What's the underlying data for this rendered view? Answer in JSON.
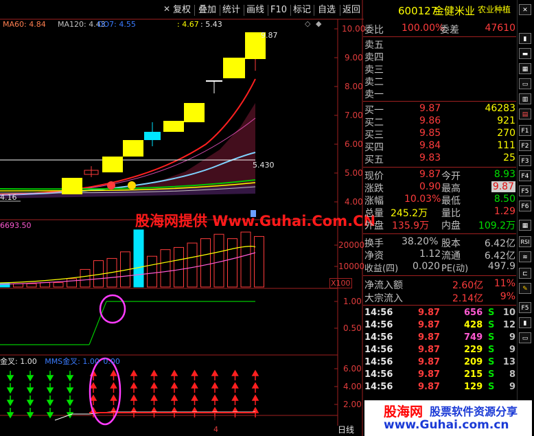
{
  "toolbar": {
    "items": [
      "复权",
      "叠加",
      "统计",
      "画线",
      "F10",
      "标记",
      "自选",
      "返回"
    ],
    "close_icon": "close-icon"
  },
  "stock": {
    "code": "600127",
    "name": "金健米业",
    "sector": "农业种植"
  },
  "chart_data": [
    {
      "type": "candlestick",
      "title": "",
      "ma_legend": [
        {
          "name": "MA60",
          "value": "4.84",
          "color": "#ff7f50"
        },
        {
          "name": "MA120",
          "value": "4.43",
          "color": "#c0c0c0"
        },
        {
          "name": "DO7",
          "value": "4.55",
          "color": "#3a7bff"
        }
      ],
      "extra_readouts": [
        "4.67",
        "5.43"
      ],
      "y_axis_ticks": [
        "10.00",
        "9.00",
        "8.00",
        "7.00",
        "6.00",
        "5.00",
        "4.00"
      ],
      "annotations": {
        "high_label": "9.87",
        "mid_label": "5.430",
        "low_label": "4.16"
      },
      "candles": [
        {
          "o": 4.16,
          "c": 4.82,
          "h": 4.82,
          "l": 4.16,
          "type": "yang-limit"
        },
        {
          "o": 5.05,
          "c": 4.95,
          "h": 5.18,
          "l": 4.9,
          "type": "doji"
        },
        {
          "o": 5.05,
          "c": 5.52,
          "h": 5.52,
          "l": 5.05,
          "type": "yang-limit"
        },
        {
          "o": 5.55,
          "c": 6.08,
          "h": 6.08,
          "l": 5.55,
          "type": "yang-limit"
        },
        {
          "o": 6.1,
          "c": 6.37,
          "h": 6.6,
          "l": 5.95,
          "type": "yin"
        },
        {
          "o": 6.33,
          "c": 6.7,
          "h": 6.7,
          "l": 6.33,
          "type": "yang-limit"
        },
        {
          "o": 6.7,
          "c": 7.37,
          "h": 7.37,
          "l": 6.5,
          "type": "yang-limit"
        },
        {
          "o": 8.1,
          "c": 8.1,
          "h": 8.1,
          "l": 7.7,
          "type": "doji"
        },
        {
          "o": 8.22,
          "c": 8.93,
          "h": 8.93,
          "l": 8.05,
          "type": "yang-limit"
        },
        {
          "o": 8.93,
          "c": 9.87,
          "h": 9.87,
          "l": 8.5,
          "type": "yang-limit"
        }
      ]
    },
    {
      "type": "bar",
      "title": "",
      "legend_value": "6693.50",
      "y_axis_ticks": [
        "20000",
        "10000"
      ],
      "unit_label": "X100",
      "values": [
        1800,
        1500,
        1500,
        2000,
        2000,
        3800,
        8000,
        12000,
        13000,
        16000,
        26000,
        14000,
        17000,
        18000,
        20000,
        22000,
        24000,
        22000,
        25000,
        23000
      ]
    },
    {
      "type": "line",
      "title": "",
      "y_axis_ticks": [
        "1.00",
        "0.50"
      ],
      "values": [
        0,
        0,
        0,
        0,
        0,
        0,
        0,
        0,
        0,
        1,
        1,
        1,
        1,
        1,
        1,
        1,
        1,
        1,
        1,
        1
      ]
    },
    {
      "type": "signal",
      "title": "",
      "legend": [
        {
          "name": "金叉",
          "value": "1.00"
        },
        {
          "name": "MMS金叉",
          "value": "1.00"
        }
      ],
      "legend_tail": "0.00",
      "y_axis_ticks": [
        "6.00",
        "4.00",
        "2.00"
      ],
      "x_marker": "4",
      "period": "日线",
      "green_arrow_columns": 4,
      "red_arrow_columns": 9
    }
  ],
  "quote": {
    "weibi_label": "委比",
    "weibi_value": "100.00%",
    "weicha_label": "委差",
    "weicha_value": "47610",
    "sell": [
      {
        "label": "卖五",
        "price": "",
        "vol": ""
      },
      {
        "label": "卖四",
        "price": "",
        "vol": ""
      },
      {
        "label": "卖三",
        "price": "",
        "vol": ""
      },
      {
        "label": "卖二",
        "price": "",
        "vol": ""
      },
      {
        "label": "卖一",
        "price": "",
        "vol": ""
      }
    ],
    "buy": [
      {
        "label": "买一",
        "price": "9.87",
        "vol": "46283"
      },
      {
        "label": "买二",
        "price": "9.86",
        "vol": "921"
      },
      {
        "label": "买三",
        "price": "9.85",
        "vol": "270"
      },
      {
        "label": "买四",
        "price": "9.84",
        "vol": "111"
      },
      {
        "label": "买五",
        "price": "9.83",
        "vol": "25"
      }
    ],
    "stats_left": [
      {
        "label": "现价",
        "value": "9.87"
      },
      {
        "label": "涨跌",
        "value": "0.90"
      },
      {
        "label": "涨幅",
        "value": "10.03%"
      },
      {
        "label": "总量",
        "value": "245.2万"
      },
      {
        "label": "外盘",
        "value": "135.9万"
      }
    ],
    "stats_right": [
      {
        "label": "今开",
        "value": "8.93"
      },
      {
        "label": "最高",
        "value": "9.87"
      },
      {
        "label": "最低",
        "value": "8.50"
      },
      {
        "label": "量比",
        "value": "1.29"
      },
      {
        "label": "内盘",
        "value": "109.2万"
      }
    ],
    "fin_left": [
      {
        "label": "换手",
        "value": "38.20%"
      },
      {
        "label": "净资",
        "value": "1.12"
      },
      {
        "label": "收益(四)",
        "value": "0.020"
      }
    ],
    "fin_right": [
      {
        "label": "股本",
        "value": "6.42亿"
      },
      {
        "label": "流通",
        "value": "6.42亿"
      },
      {
        "label": "PE(动)",
        "value": "497.9"
      }
    ],
    "flows": [
      {
        "label": "净流入额",
        "value": "2.60亿",
        "pct": "11%"
      },
      {
        "label": "大宗流入",
        "value": "2.14亿",
        "pct": "9%"
      }
    ]
  },
  "ticks": [
    {
      "time": "14:56",
      "price": "9.87",
      "vol": "656",
      "side": "S",
      "num": "10",
      "vol_color": "#ff5ad2"
    },
    {
      "time": "14:56",
      "price": "9.87",
      "vol": "428",
      "side": "S",
      "num": "12",
      "vol_color": "#ffff00"
    },
    {
      "time": "14:56",
      "price": "9.87",
      "vol": "749",
      "side": "S",
      "num": "9",
      "vol_color": "#ff5ad2"
    },
    {
      "time": "14:56",
      "price": "9.87",
      "vol": "229",
      "side": "S",
      "num": "9",
      "vol_color": "#ffff00"
    },
    {
      "time": "14:56",
      "price": "9.87",
      "vol": "209",
      "side": "S",
      "num": "13",
      "vol_color": "#ffff00"
    },
    {
      "time": "14:56",
      "price": "9.87",
      "vol": "215",
      "side": "S",
      "num": "8",
      "vol_color": "#ffff00"
    },
    {
      "time": "14:56",
      "price": "9.87",
      "vol": "129",
      "side": "S",
      "num": "9",
      "vol_color": "#ffff00"
    }
  ],
  "right_sidebar": {
    "icons": [
      "close-icon",
      "F1",
      "F2",
      "F3",
      "F4",
      "F5",
      "F6",
      "RSI"
    ]
  },
  "watermark": {
    "center": "股海网提供 Www.Guhai.Com.CN",
    "logo_text": "股海网",
    "logo_slogan": "股票软件资源分享",
    "logo_url": "www.Guhai.com.cn"
  }
}
